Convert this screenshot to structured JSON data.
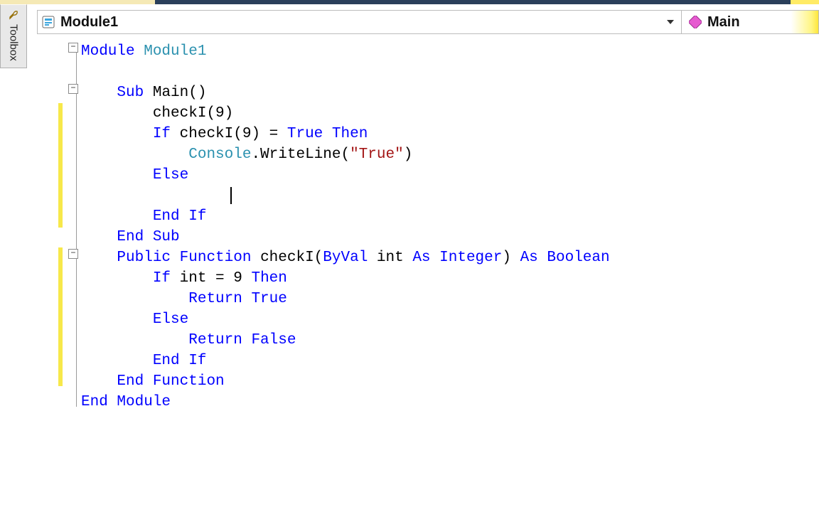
{
  "toolbox": {
    "label": "Toolbox"
  },
  "dropdown": {
    "left": "Module1",
    "right": "Main"
  },
  "code": {
    "l1_kw": "Module ",
    "l1_name": "Module1",
    "l3_kw": "Sub ",
    "l3_name": "Main()",
    "l4": "checkI(9)",
    "l5_if": "If ",
    "l5_expr": "checkI(9) = ",
    "l5_true": "True ",
    "l5_then": "Then",
    "l6_con": "Console",
    "l6_dot": ".WriteLine(",
    "l6_str": "\"True\"",
    "l6_close": ")",
    "l7_else": "Else",
    "l9_endif": "End If",
    "l10_endsub": "End Sub",
    "l11_pub": "Public Function ",
    "l11_name": "checkI(",
    "l11_byval": "ByVal ",
    "l11_p": "int ",
    "l11_as1": "As Integer",
    "l11_paren": ") ",
    "l11_as2": "As Boolean",
    "l12_if": "If ",
    "l12_expr": "int = 9 ",
    "l12_then": "Then",
    "l13_ret": "Return True",
    "l14_else": "Else",
    "l15_ret": "Return False",
    "l16_endif": "End If",
    "l17_endfn": "End Function",
    "l18_endmod": "End Module"
  }
}
